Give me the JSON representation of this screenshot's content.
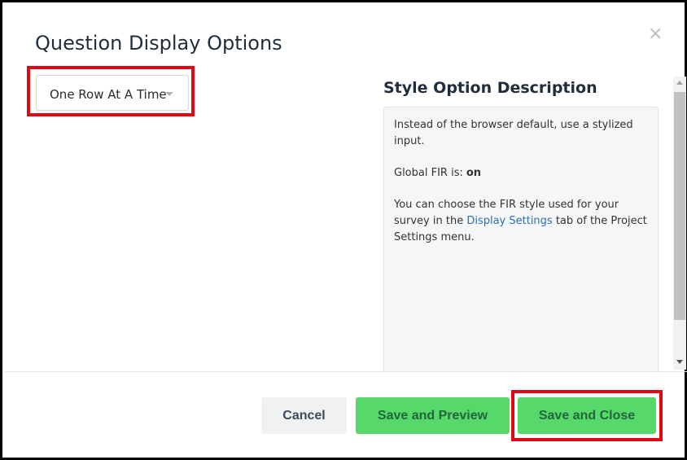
{
  "modal": {
    "title": "Question Display Options",
    "close_glyph": "×"
  },
  "display_style": {
    "selected": "One Row At A Time"
  },
  "description": {
    "heading": "Style Option Description",
    "line1": "Instead of the browser default, use a stylized input.",
    "global_fir_label": "Global FIR is:",
    "global_fir_value": "on",
    "line3_before": "You can choose the FIR style used for your survey in the ",
    "link_text": "Display Settings",
    "line3_after": " tab of the Project Settings menu."
  },
  "footer": {
    "cancel_label": "Cancel",
    "preview_label": "Save and Preview",
    "save_close_label": "Save and Close"
  },
  "colors": {
    "highlight": "#e30613",
    "primary_button": "#56d86a",
    "link": "#2a6ebb"
  },
  "icons": {
    "close": "close-icon",
    "dropdown": "caret-down-icon"
  }
}
